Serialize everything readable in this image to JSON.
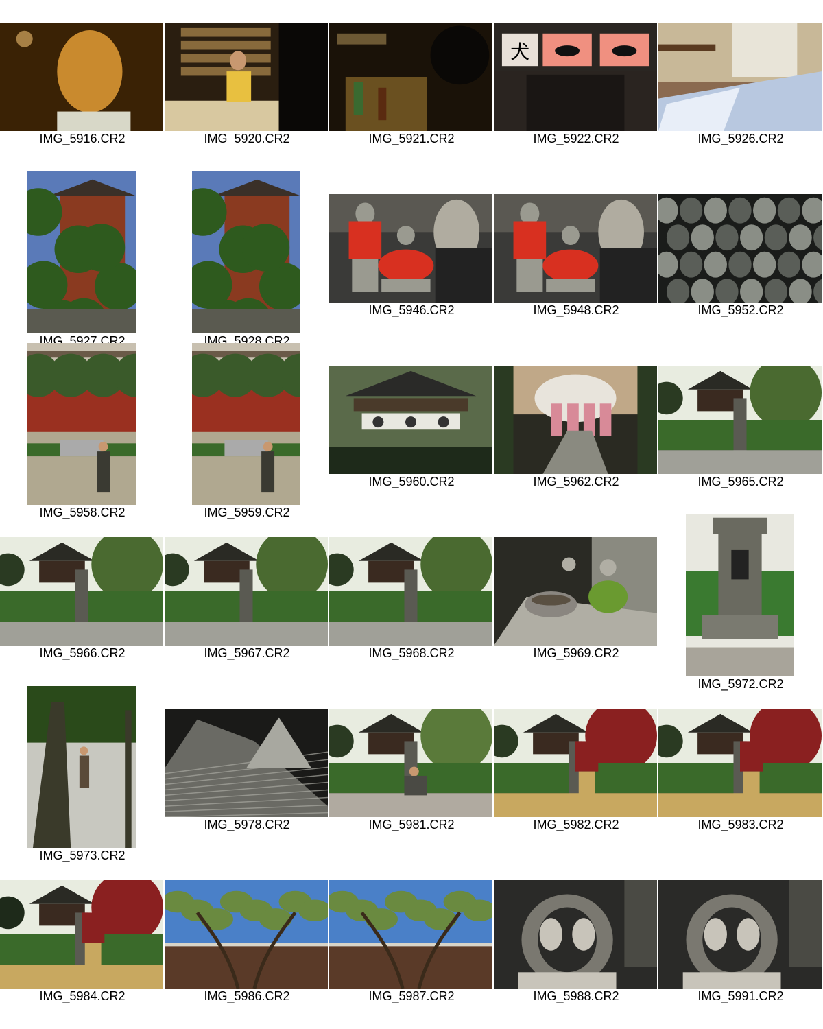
{
  "sheet": {
    "rows": [
      [
        {
          "name": "IMG_5916.CR2",
          "orient": "landscape",
          "scene": "portrait-man",
          "colors": [
            "#3a2205",
            "#c98a2e",
            "#f0c070"
          ]
        },
        {
          "name": "IMG  5920.CR2",
          "orient": "landscape",
          "scene": "kitchen-woman",
          "colors": [
            "#2a1e10",
            "#b08a50",
            "#e8c040"
          ]
        },
        {
          "name": "IMG_5921.CR2",
          "orient": "landscape",
          "scene": "bar-counter",
          "colors": [
            "#1a1208",
            "#6a5020",
            "#c0a060"
          ]
        },
        {
          "name": "IMG_5922.CR2",
          "orient": "landscape",
          "scene": "dog-sign",
          "colors": [
            "#2a2420",
            "#f09080",
            "#e8e0d8"
          ]
        },
        {
          "name": "IMG_5926.CR2",
          "orient": "landscape",
          "scene": "futon-room",
          "colors": [
            "#8a6a50",
            "#b8c8e0",
            "#e8e0d0"
          ]
        }
      ],
      [
        {
          "name": "IMG_5927.CR2",
          "orient": "portrait",
          "scene": "pine-temple",
          "colors": [
            "#5a7ab8",
            "#2e5a1e",
            "#8a3a20"
          ]
        },
        {
          "name": "IMG_5928.CR2",
          "orient": "portrait",
          "scene": "pine-temple",
          "colors": [
            "#5a7ab8",
            "#2e5a1e",
            "#8a3a20"
          ]
        },
        {
          "name": "IMG_5946.CR2",
          "orient": "landscape",
          "scene": "jizo-bibs",
          "colors": [
            "#3a3a38",
            "#d83020",
            "#9a9a90"
          ]
        },
        {
          "name": "IMG_5948.CR2",
          "orient": "landscape",
          "scene": "jizo-bibs",
          "colors": [
            "#3a3a38",
            "#d83020",
            "#9a9a90"
          ]
        },
        {
          "name": "IMG_5952.CR2",
          "orient": "landscape",
          "scene": "stone-field",
          "colors": [
            "#1a1c1a",
            "#5a5e58",
            "#8a8e86"
          ]
        }
      ],
      [
        {
          "name": "IMG_5958.CR2",
          "orient": "portrait",
          "scene": "man-gate",
          "colors": [
            "#b0a890",
            "#3a5a2a",
            "#9a3020"
          ]
        },
        {
          "name": "IMG_5959.CR2",
          "orient": "portrait",
          "scene": "man-gate",
          "colors": [
            "#b0a890",
            "#3a5a2a",
            "#9a3020"
          ]
        },
        {
          "name": "IMG_5960.CR2",
          "orient": "landscape",
          "scene": "lantern-gate",
          "colors": [
            "#1e2a1a",
            "#5a6a4a",
            "#e8e8e0"
          ]
        },
        {
          "name": "IMG_5962.CR2",
          "orient": "landscape",
          "scene": "kimono-path",
          "colors": [
            "#2a2a22",
            "#c0a888",
            "#d88a98"
          ]
        },
        {
          "name": "IMG_5965.CR2",
          "orient": "landscape",
          "scene": "garden-pagoda",
          "colors": [
            "#2a3a22",
            "#4a6a30",
            "#a0a098"
          ]
        }
      ],
      [
        {
          "name": "IMG_5966.CR2",
          "orient": "landscape",
          "scene": "garden-pagoda",
          "colors": [
            "#2a3a22",
            "#4a6a30",
            "#a0a098"
          ]
        },
        {
          "name": "IMG_5967.CR2",
          "orient": "landscape",
          "scene": "garden-pagoda",
          "colors": [
            "#2a3a22",
            "#4a6a30",
            "#a0a098"
          ]
        },
        {
          "name": "IMG_5968.CR2",
          "orient": "landscape",
          "scene": "garden-pagoda",
          "colors": [
            "#2a3a22",
            "#4a6a30",
            "#a0a098"
          ]
        },
        {
          "name": "IMG_5969.CR2",
          "orient": "landscape",
          "scene": "moss-bowl",
          "colors": [
            "#2a2a24",
            "#6a9a30",
            "#b0aea4"
          ]
        },
        {
          "name": "IMG_5972.CR2",
          "orient": "portrait",
          "scene": "stone-lantern",
          "colors": [
            "#e8e8e0",
            "#6a6a60",
            "#3a7a30"
          ]
        }
      ],
      [
        {
          "name": "IMG_5973.CR2",
          "orient": "portrait",
          "scene": "woman-trees",
          "colors": [
            "#c8c8c0",
            "#3a3a2a",
            "#2a4a1a"
          ]
        },
        {
          "name": "IMG_5978.CR2",
          "orient": "landscape",
          "scene": "sand-cones",
          "colors": [
            "#1a1a18",
            "#6a6a64",
            "#a8a8a0"
          ]
        },
        {
          "name": "IMG_5981.CR2",
          "orient": "landscape",
          "scene": "garden-kneel",
          "colors": [
            "#2a3a22",
            "#5a7a3a",
            "#b0aaa0"
          ]
        },
        {
          "name": "IMG_5982.CR2",
          "orient": "landscape",
          "scene": "garden-stand",
          "colors": [
            "#2a3a22",
            "#8a2020",
            "#c8a860"
          ]
        },
        {
          "name": "IMG_5983.CR2",
          "orient": "landscape",
          "scene": "garden-stand",
          "colors": [
            "#2a3a22",
            "#8a2020",
            "#c8a860"
          ]
        }
      ],
      [
        {
          "name": "IMG_5984.CR2",
          "orient": "landscape",
          "scene": "garden-bend",
          "colors": [
            "#1e2a1a",
            "#8a2020",
            "#c8a860"
          ]
        },
        {
          "name": "IMG_5986.CR2",
          "orient": "landscape",
          "scene": "pine-wall",
          "colors": [
            "#4a80c8",
            "#5a3a28",
            "#6a8a40"
          ]
        },
        {
          "name": "IMG_5987.CR2",
          "orient": "landscape",
          "scene": "pine-wall",
          "colors": [
            "#4a80c8",
            "#5a3a28",
            "#6a8a40"
          ]
        },
        {
          "name": "IMG_5988.CR2",
          "orient": "landscape",
          "scene": "stone-carving",
          "colors": [
            "#2a2a28",
            "#7a7870",
            "#c8c4ba"
          ]
        },
        {
          "name": "IMG_5991.CR2",
          "orient": "landscape",
          "scene": "stone-carving",
          "colors": [
            "#2a2a28",
            "#7a7870",
            "#c8c4ba"
          ]
        }
      ]
    ]
  }
}
